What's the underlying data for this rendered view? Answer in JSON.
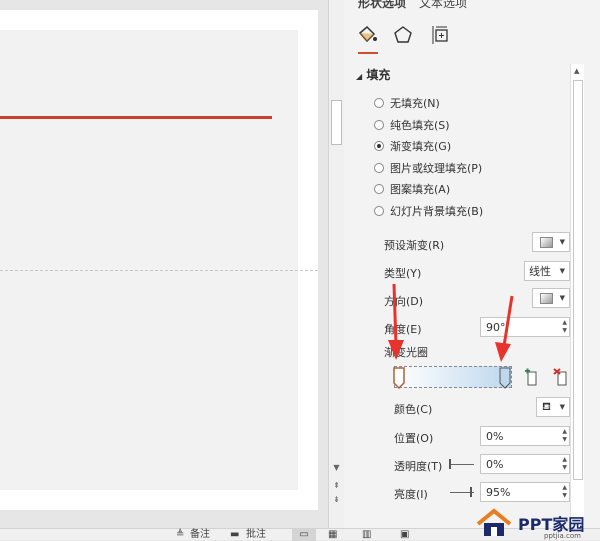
{
  "pane": {
    "tabs": [
      "形状选项",
      "文本选项"
    ],
    "section_title": "填充",
    "fill_options": [
      {
        "label": "无填充(N)",
        "checked": false
      },
      {
        "label": "纯色填充(S)",
        "checked": false
      },
      {
        "label": "渐变填充(G)",
        "checked": true
      },
      {
        "label": "图片或纹理填充(P)",
        "checked": false
      },
      {
        "label": "图案填充(A)",
        "checked": false
      },
      {
        "label": "幻灯片背景填充(B)",
        "checked": false
      }
    ],
    "preset_gradient_label": "预设渐变(R)",
    "type_label": "类型(Y)",
    "type_value": "线性",
    "direction_label": "方向(D)",
    "angle_label": "角度(E)",
    "angle_value": "90°",
    "gradient_stops_label": "渐变光圈",
    "color_label": "颜色(C)",
    "position_label": "位置(O)",
    "position_value": "0%",
    "transparency_label": "透明度(T)",
    "transparency_value": "0%",
    "brightness_label": "亮度(I)",
    "brightness_value": "95%"
  },
  "status_bar": {
    "notes_label": "备注",
    "comments_label": "批注"
  },
  "watermark": {
    "brand": "PPT家园",
    "url": "pptjia.com"
  },
  "colors": {
    "accent_red": "#c9412e",
    "arrow_red": "#e8322c",
    "gradient_end": "#bdd7ee"
  }
}
